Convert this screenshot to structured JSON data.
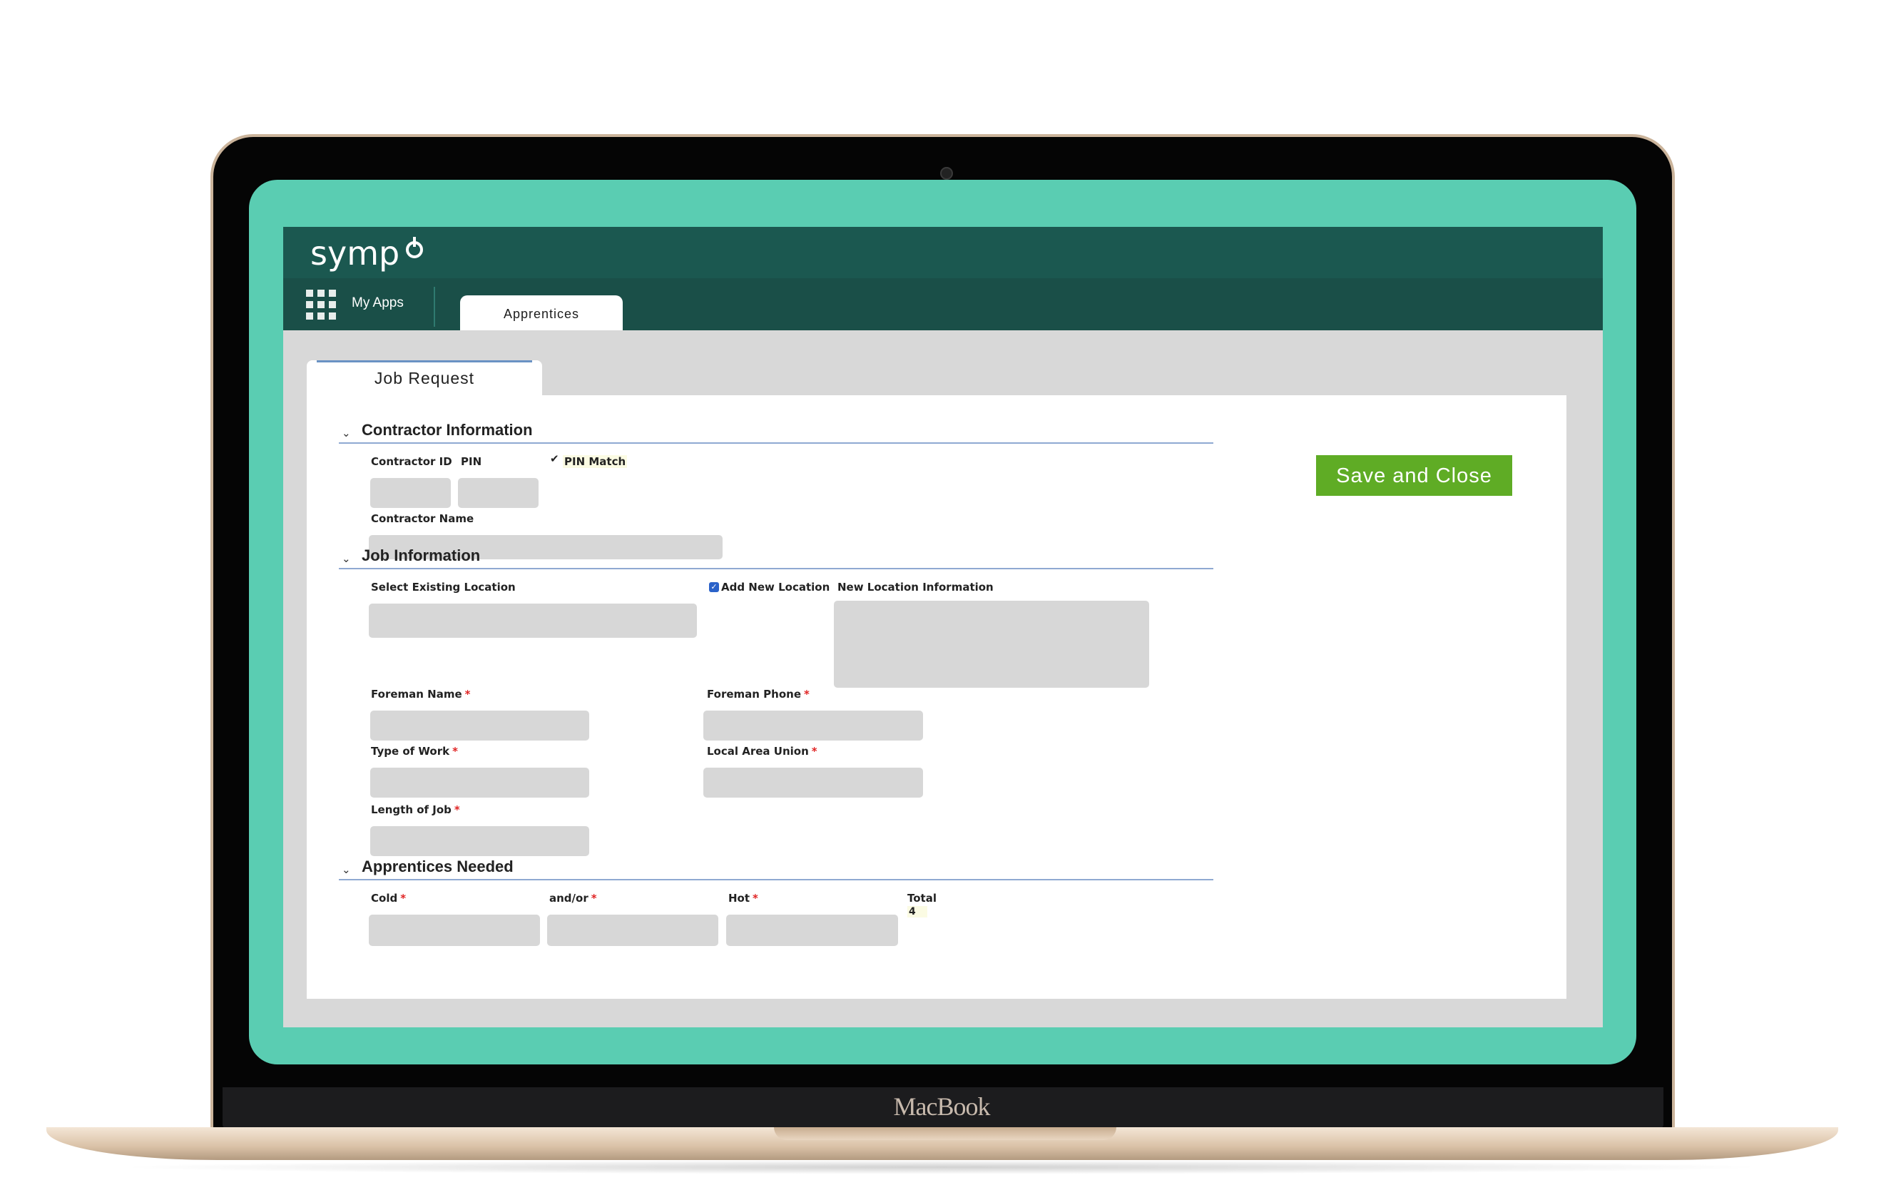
{
  "device": {
    "brand": "MacBook"
  },
  "app": {
    "logo": "symp",
    "nav": {
      "my_apps": "My Apps",
      "tab": "Apprentices"
    },
    "page_tab": "Job Request",
    "save_button": "Save and Close"
  },
  "contractor": {
    "title": "Contractor Information",
    "contractor_id": "Contractor ID",
    "pin": "PIN",
    "pin_match": "PIN Match",
    "contractor_name": "Contractor Name"
  },
  "job": {
    "title": "Job Information",
    "select_existing_location": "Select Existing Location",
    "add_new_location": "Add New Location",
    "new_location_information": "New Location Information",
    "foreman_name": "Foreman Name",
    "foreman_phone": "Foreman Phone",
    "type_of_work": "Type of Work",
    "local_area_union": "Local Area Union",
    "length_of_job": "Length of Job",
    "required_mark": "*"
  },
  "apprentices": {
    "title": "Apprentices Needed",
    "cold": "Cold",
    "and_or": "and/or",
    "hot": "Hot",
    "total": "Total",
    "total_value": "4"
  },
  "colors": {
    "screen": "#5acdb2",
    "header": "#1b5850",
    "navbar": "#1a4f48",
    "save": "#5fac25",
    "section_line": "#8fa9d2",
    "required": "#e02424"
  }
}
